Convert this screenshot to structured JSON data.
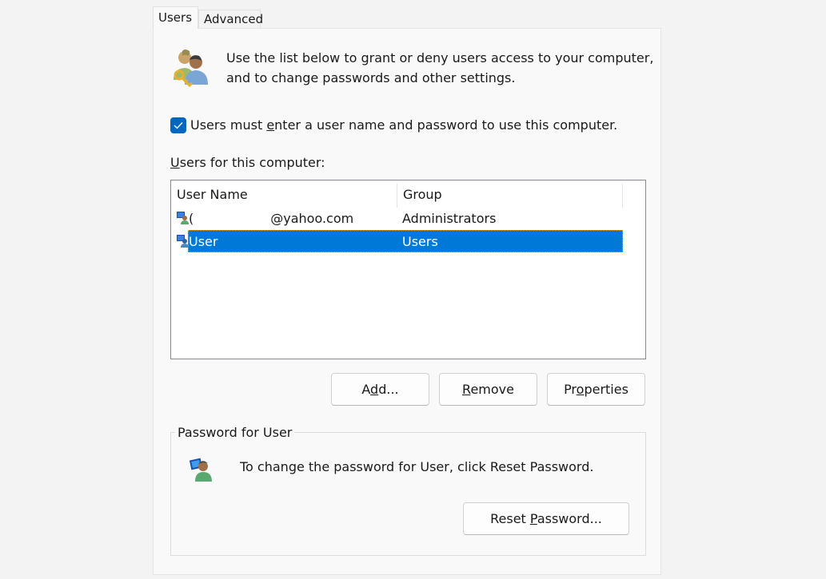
{
  "tabs": [
    {
      "label": "Users",
      "active": true
    },
    {
      "label": "Advanced",
      "active": false
    }
  ],
  "intro": {
    "icon": "users-key-icon",
    "line1": "Use the list below to grant or deny users access to your computer,",
    "line2": "and to change passwords and other settings."
  },
  "require_login": {
    "checked": true,
    "label_pre": "Users must ",
    "label_accel": "e",
    "label_post": "nter a user name and password to use this computer."
  },
  "users_list": {
    "label_accel": "U",
    "label_post": "sers for this computer:",
    "columns": [
      "User Name",
      "Group"
    ],
    "rows": [
      {
        "name_visible_prefix": "(",
        "name_suffix": "@yahoo.com",
        "group": "Administrators",
        "selected": false,
        "icon": "user-computer-icon"
      },
      {
        "name": "User",
        "group": "Users",
        "selected": true,
        "icon": "user-computer-icon"
      }
    ]
  },
  "buttons": {
    "add": {
      "pre": "A",
      "accel": "d",
      "post": "d..."
    },
    "remove": {
      "pre": "",
      "accel": "R",
      "post": "emove"
    },
    "properties": {
      "pre": "Pr",
      "accel": "o",
      "post": "perties"
    }
  },
  "password_group": {
    "title": "Password for User",
    "icon": "user-computer-icon",
    "text": "To change the password for User, click Reset Password.",
    "reset_button": {
      "pre": "Reset ",
      "accel": "P",
      "post": "assword..."
    }
  },
  "colors": {
    "accent": "#0067c0",
    "selection": "#0078d7"
  }
}
